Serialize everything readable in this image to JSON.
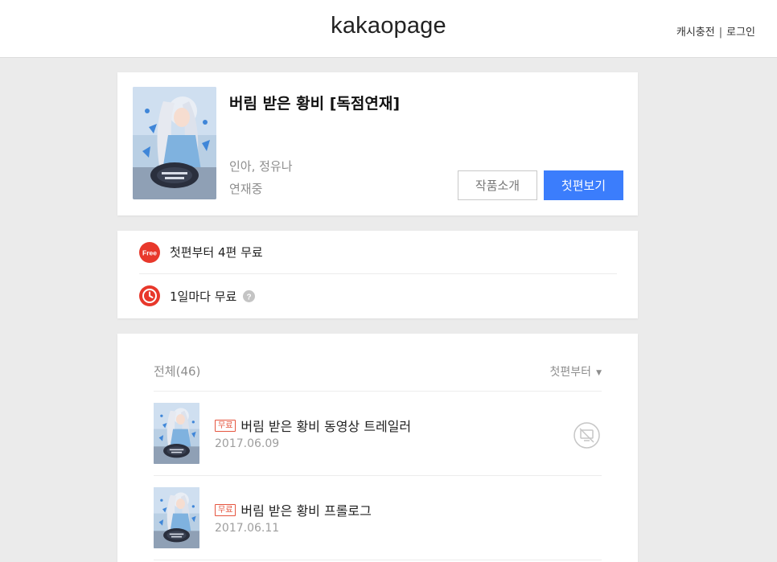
{
  "header": {
    "logo": "kakaopage",
    "cash_link": "캐시충전",
    "separator": "|",
    "login_link": "로그인"
  },
  "series": {
    "title": "버림 받은 황비 [독점연재]",
    "authors": "인아, 정유나",
    "status": "연재중",
    "intro_button": "작품소개",
    "first_button": "첫편보기"
  },
  "info": {
    "free_label": "첫편부터 4편 무료",
    "daily_label": "1일마다 무료",
    "free_badge": "Free"
  },
  "list": {
    "total": "전체(46)",
    "sort": "첫편부터",
    "caret": "▼",
    "episodes": [
      {
        "tag": "무료",
        "title": "버림 받은 황비 동영상 트레일러",
        "date": "2017.06.09",
        "icon": "no-video-icon"
      },
      {
        "tag": "무료",
        "title": "버림 받은 황비 프롤로그",
        "date": "2017.06.11"
      }
    ]
  },
  "colors": {
    "accent": "#3b7dfc",
    "free_red": "#e5553f",
    "background": "#ebebeb"
  }
}
